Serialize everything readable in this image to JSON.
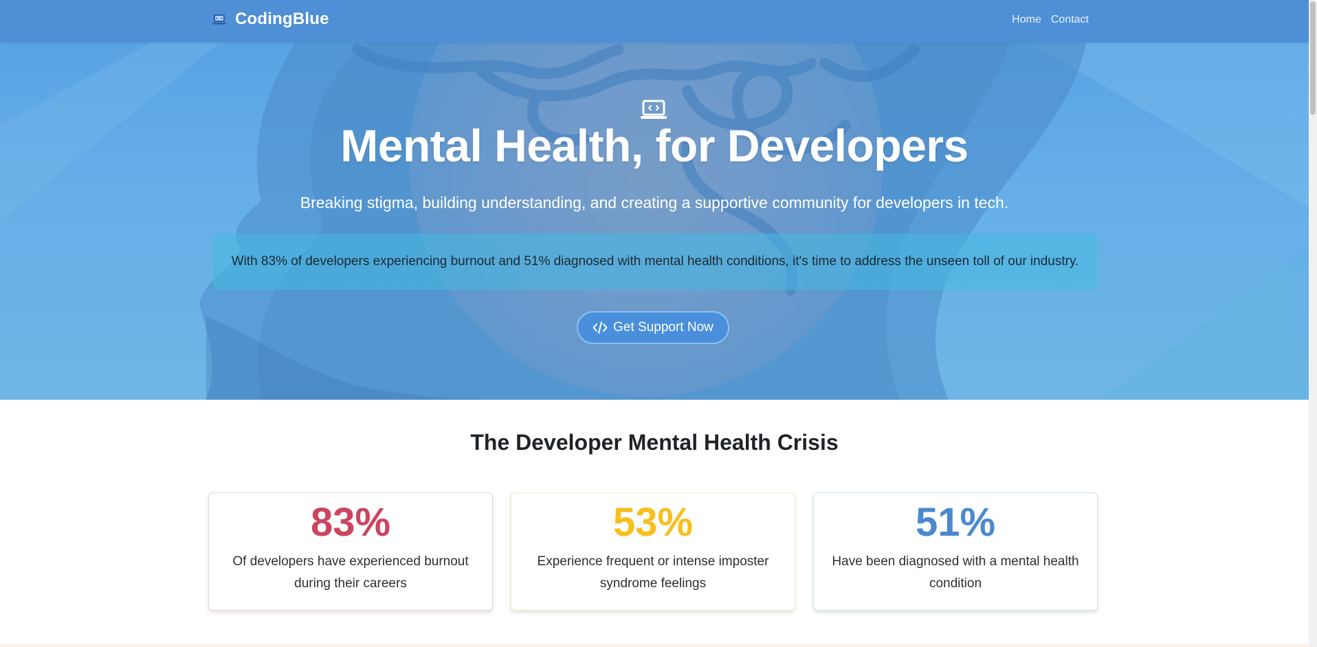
{
  "navbar": {
    "brand": "CodingBlue",
    "brand_icon": "laptop-code-icon",
    "links": [
      "Home",
      "Contact"
    ]
  },
  "hero": {
    "icon": "laptop-code-icon",
    "title": "Mental Health, for Developers",
    "subtitle": "Breaking stigma, building understanding, and creating a supportive community for developers in tech.",
    "note": "With 83% of developers experiencing burnout and 51% diagnosed with mental health conditions, it's time to address the unseen toll of our industry.",
    "cta_label": "Get Support Now",
    "cta_icon": "code-icon"
  },
  "crisis": {
    "title": "The Developer Mental Health Crisis",
    "stats": [
      {
        "value": "83%",
        "description": "Of developers have experienced burnout during their careers",
        "color": "#cc4560"
      },
      {
        "value": "53%",
        "description": "Experience frequent or intense imposter syndrome feelings",
        "color": "#f7bf1e"
      },
      {
        "value": "51%",
        "description": "Have been diagnosed with a mental health condition",
        "color": "#4b89cf"
      }
    ]
  },
  "colors": {
    "navbar": "#4f8fd6",
    "hero_sky": "#5aa3e4",
    "cta": "#4a8fdc"
  }
}
